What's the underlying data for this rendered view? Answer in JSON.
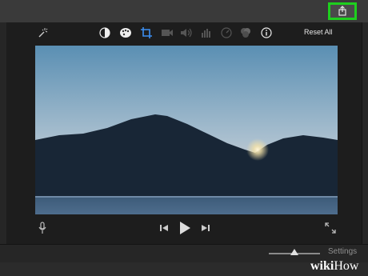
{
  "toolbar": {
    "reset_all_label": "Reset All",
    "icons": [
      "magic-wand-icon",
      "color-balance-icon",
      "color-palette-icon",
      "crop-icon",
      "stabilization-icon",
      "volume-icon",
      "noise-equalizer-icon",
      "speed-icon",
      "clip-filter-icon",
      "info-icon"
    ]
  },
  "share": {
    "icon": "share-icon"
  },
  "playback": {
    "icons": [
      "microphone-icon",
      "skip-back-icon",
      "play-icon",
      "skip-forward-icon",
      "fullscreen-icon"
    ]
  },
  "bottom": {
    "settings_label": "Settings",
    "zoom_level": 0.45
  },
  "watermark": {
    "brand": "wiki",
    "suffix": "How"
  },
  "colors": {
    "highlight": "#1ecf1e",
    "bg": "#2a2a2a"
  }
}
